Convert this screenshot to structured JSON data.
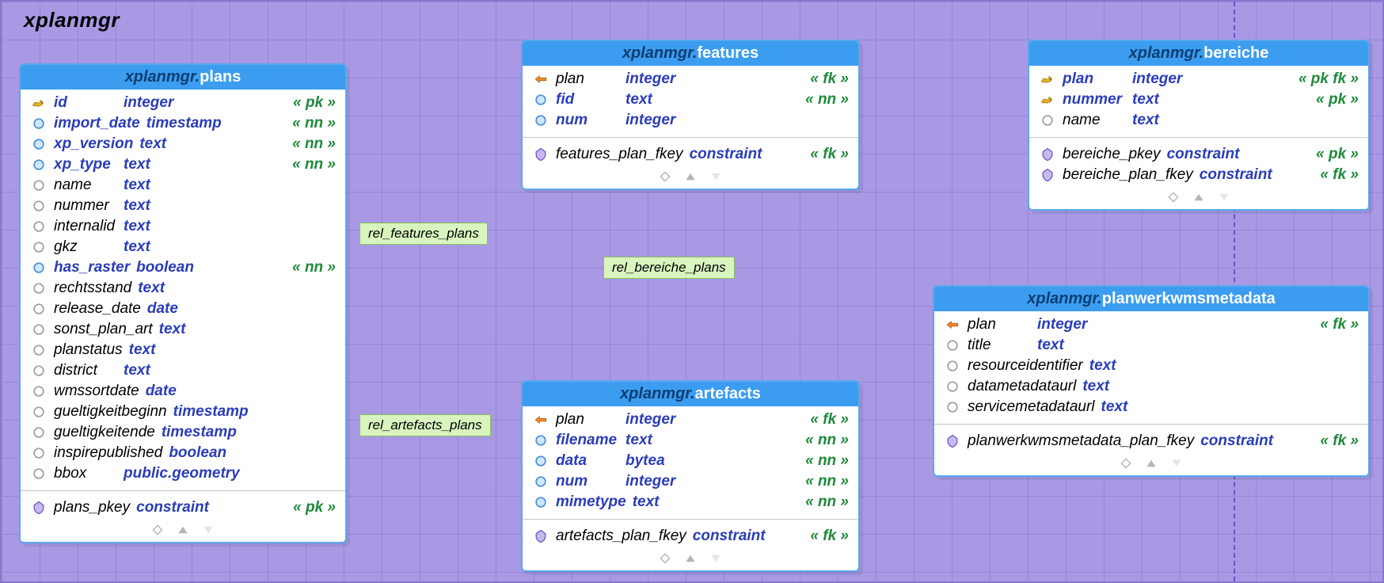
{
  "schema_title": "xplanmgr",
  "tables": {
    "plans": {
      "prefix": "xplanmgr.",
      "name": "plans",
      "columns": [
        {
          "icon": "pk",
          "name": "id",
          "type": "integer",
          "flags": "« pk »",
          "cls": "key"
        },
        {
          "icon": "nn",
          "name": "import_date",
          "type": "timestamp",
          "flags": "« nn »",
          "cls": "nn"
        },
        {
          "icon": "nn",
          "name": "xp_version",
          "type": "text",
          "flags": "« nn »",
          "cls": "nn"
        },
        {
          "icon": "nn",
          "name": "xp_type",
          "type": "text",
          "flags": "« nn »",
          "cls": "nn"
        },
        {
          "icon": "col",
          "name": "name",
          "type": "text",
          "flags": ""
        },
        {
          "icon": "col",
          "name": "nummer",
          "type": "text",
          "flags": ""
        },
        {
          "icon": "col",
          "name": "internalid",
          "type": "text",
          "flags": ""
        },
        {
          "icon": "col",
          "name": "gkz",
          "type": "text",
          "flags": ""
        },
        {
          "icon": "nn",
          "name": "has_raster",
          "type": "boolean",
          "flags": "« nn »",
          "cls": "nn"
        },
        {
          "icon": "col",
          "name": "rechtsstand",
          "type": "text",
          "flags": ""
        },
        {
          "icon": "col",
          "name": "release_date",
          "type": "date",
          "flags": ""
        },
        {
          "icon": "col",
          "name": "sonst_plan_art",
          "type": "text",
          "flags": ""
        },
        {
          "icon": "col",
          "name": "planstatus",
          "type": "text",
          "flags": ""
        },
        {
          "icon": "col",
          "name": "district",
          "type": "text",
          "flags": ""
        },
        {
          "icon": "col",
          "name": "wmssortdate",
          "type": "date",
          "flags": ""
        },
        {
          "icon": "col",
          "name": "gueltigkeitbeginn",
          "type": "timestamp",
          "flags": ""
        },
        {
          "icon": "col",
          "name": "gueltigkeitende",
          "type": "timestamp",
          "flags": ""
        },
        {
          "icon": "col",
          "name": "inspirepublished",
          "type": "boolean",
          "flags": ""
        },
        {
          "icon": "col",
          "name": "bbox",
          "type": "public.geometry",
          "flags": ""
        }
      ],
      "constraints": [
        {
          "icon": "cons",
          "name": "plans_pkey",
          "type": "constraint",
          "flags": "« pk »"
        }
      ]
    },
    "features": {
      "prefix": "xplanmgr.",
      "name": "features",
      "columns": [
        {
          "icon": "fk",
          "name": "plan",
          "type": "integer",
          "flags": "« fk »"
        },
        {
          "icon": "nn",
          "name": "fid",
          "type": "text",
          "flags": "« nn »",
          "cls": "nn"
        },
        {
          "icon": "nn",
          "name": "num",
          "type": "integer",
          "flags": "",
          "cls": "nn"
        }
      ],
      "constraints": [
        {
          "icon": "cons",
          "name": "features_plan_fkey",
          "type": "constraint",
          "flags": "« fk »"
        }
      ]
    },
    "artefacts": {
      "prefix": "xplanmgr.",
      "name": "artefacts",
      "columns": [
        {
          "icon": "fk",
          "name": "plan",
          "type": "integer",
          "flags": "« fk »"
        },
        {
          "icon": "nn",
          "name": "filename",
          "type": "text",
          "flags": "« nn »",
          "cls": "nn"
        },
        {
          "icon": "nn",
          "name": "data",
          "type": "bytea",
          "flags": "« nn »",
          "cls": "nn"
        },
        {
          "icon": "nn",
          "name": "num",
          "type": "integer",
          "flags": "« nn »",
          "cls": "nn"
        },
        {
          "icon": "nn",
          "name": "mimetype",
          "type": "text",
          "flags": "« nn »",
          "cls": "nn"
        }
      ],
      "constraints": [
        {
          "icon": "cons",
          "name": "artefacts_plan_fkey",
          "type": "constraint",
          "flags": "« fk »"
        }
      ]
    },
    "bereiche": {
      "prefix": "xplanmgr.",
      "name": "bereiche",
      "columns": [
        {
          "icon": "pk",
          "name": "plan",
          "type": "integer",
          "flags": "« pk fk »",
          "cls": "key"
        },
        {
          "icon": "pk",
          "name": "nummer",
          "type": "text",
          "flags": "« pk »",
          "cls": "key"
        },
        {
          "icon": "col",
          "name": "name",
          "type": "text",
          "flags": ""
        }
      ],
      "constraints": [
        {
          "icon": "cons",
          "name": "bereiche_pkey",
          "type": "constraint",
          "flags": "« pk »"
        },
        {
          "icon": "cons",
          "name": "bereiche_plan_fkey",
          "type": "constraint",
          "flags": "« fk »"
        }
      ]
    },
    "planwerkwmsmetadata": {
      "prefix": "xplanmgr.",
      "name": "planwerkwmsmetadata",
      "columns": [
        {
          "icon": "fk",
          "name": "plan",
          "type": "integer",
          "flags": "« fk »"
        },
        {
          "icon": "col",
          "name": "title",
          "type": "text",
          "flags": ""
        },
        {
          "icon": "col",
          "name": "resourceidentifier",
          "type": "text",
          "flags": ""
        },
        {
          "icon": "col",
          "name": "datametadataurl",
          "type": "text",
          "flags": ""
        },
        {
          "icon": "col",
          "name": "servicemetadataurl",
          "type": "text",
          "flags": ""
        }
      ],
      "constraints": [
        {
          "icon": "cons",
          "name": "planwerkwmsmetadata_plan_fkey",
          "type": "constraint",
          "flags": "« fk »"
        }
      ]
    }
  },
  "relations": {
    "r1": "rel_features_plans",
    "r2": "rel_bereiche_plans",
    "r3": "rel_artefacts_plans"
  }
}
